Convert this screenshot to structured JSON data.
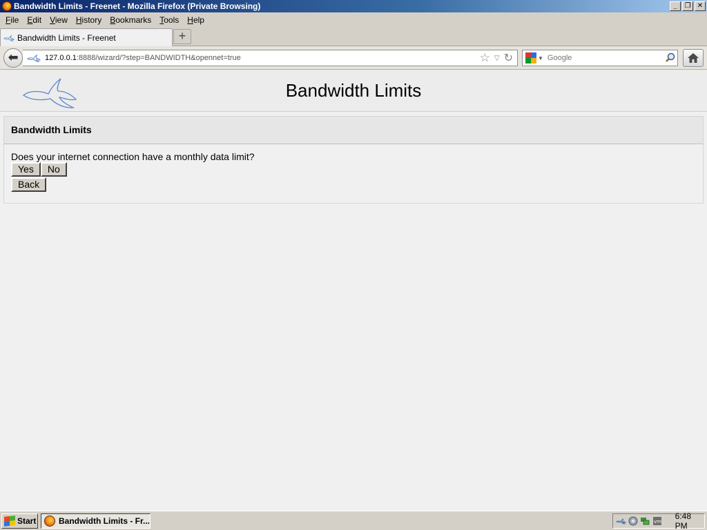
{
  "window": {
    "title": "Bandwidth Limits - Freenet - Mozilla Firefox (Private Browsing)",
    "controls": {
      "minimize": "_",
      "restore": "❐",
      "close": "✕"
    }
  },
  "menubar": {
    "items": [
      {
        "accel": "F",
        "rest": "ile"
      },
      {
        "accel": "E",
        "rest": "dit"
      },
      {
        "accel": "V",
        "rest": "iew"
      },
      {
        "accel": "H",
        "rest": "istory"
      },
      {
        "accel": "B",
        "rest": "ookmarks"
      },
      {
        "accel": "T",
        "rest": "ools"
      },
      {
        "accel": "H",
        "rest": "elp"
      }
    ]
  },
  "tabs": {
    "active_label": "Bandwidth Limits - Freenet",
    "new_tab_symbol": "+"
  },
  "navbar": {
    "back_symbol": "⬅",
    "url_host": "127.0.0.1",
    "url_rest": ":8888/wizard/?step=BANDWIDTH&opennet=true",
    "search_placeholder": "Google",
    "bookmark_star": "☆",
    "dropdown": "▽",
    "reload": "↻",
    "search_drop": "▼",
    "search_go": "🔍"
  },
  "page": {
    "header_title": "Bandwidth Limits",
    "infobox": {
      "title": "Bandwidth Limits",
      "question": "Does your internet connection have a monthly data limit?",
      "yes_label": "Yes",
      "no_label": "No",
      "back_label": "Back"
    }
  },
  "taskbar": {
    "start_label": "Start",
    "task_label": "Bandwidth Limits - Fr...",
    "clock": "6:48 PM"
  },
  "colors": {
    "titlebar_start": "#0a246a",
    "titlebar_end": "#a6caf0",
    "page_bg": "#f0f0f0",
    "logo_stroke": "#5b86c9"
  },
  "icons": [
    "firefox-icon",
    "freenet-rabbit-icon",
    "bookmark-star-icon",
    "reload-icon",
    "google-icon",
    "magnifier-icon",
    "home-icon",
    "windows-logo-icon",
    "tray-freenet-icon",
    "tray-speaker-icon",
    "tray-network-icon",
    "tray-vm-icon"
  ]
}
